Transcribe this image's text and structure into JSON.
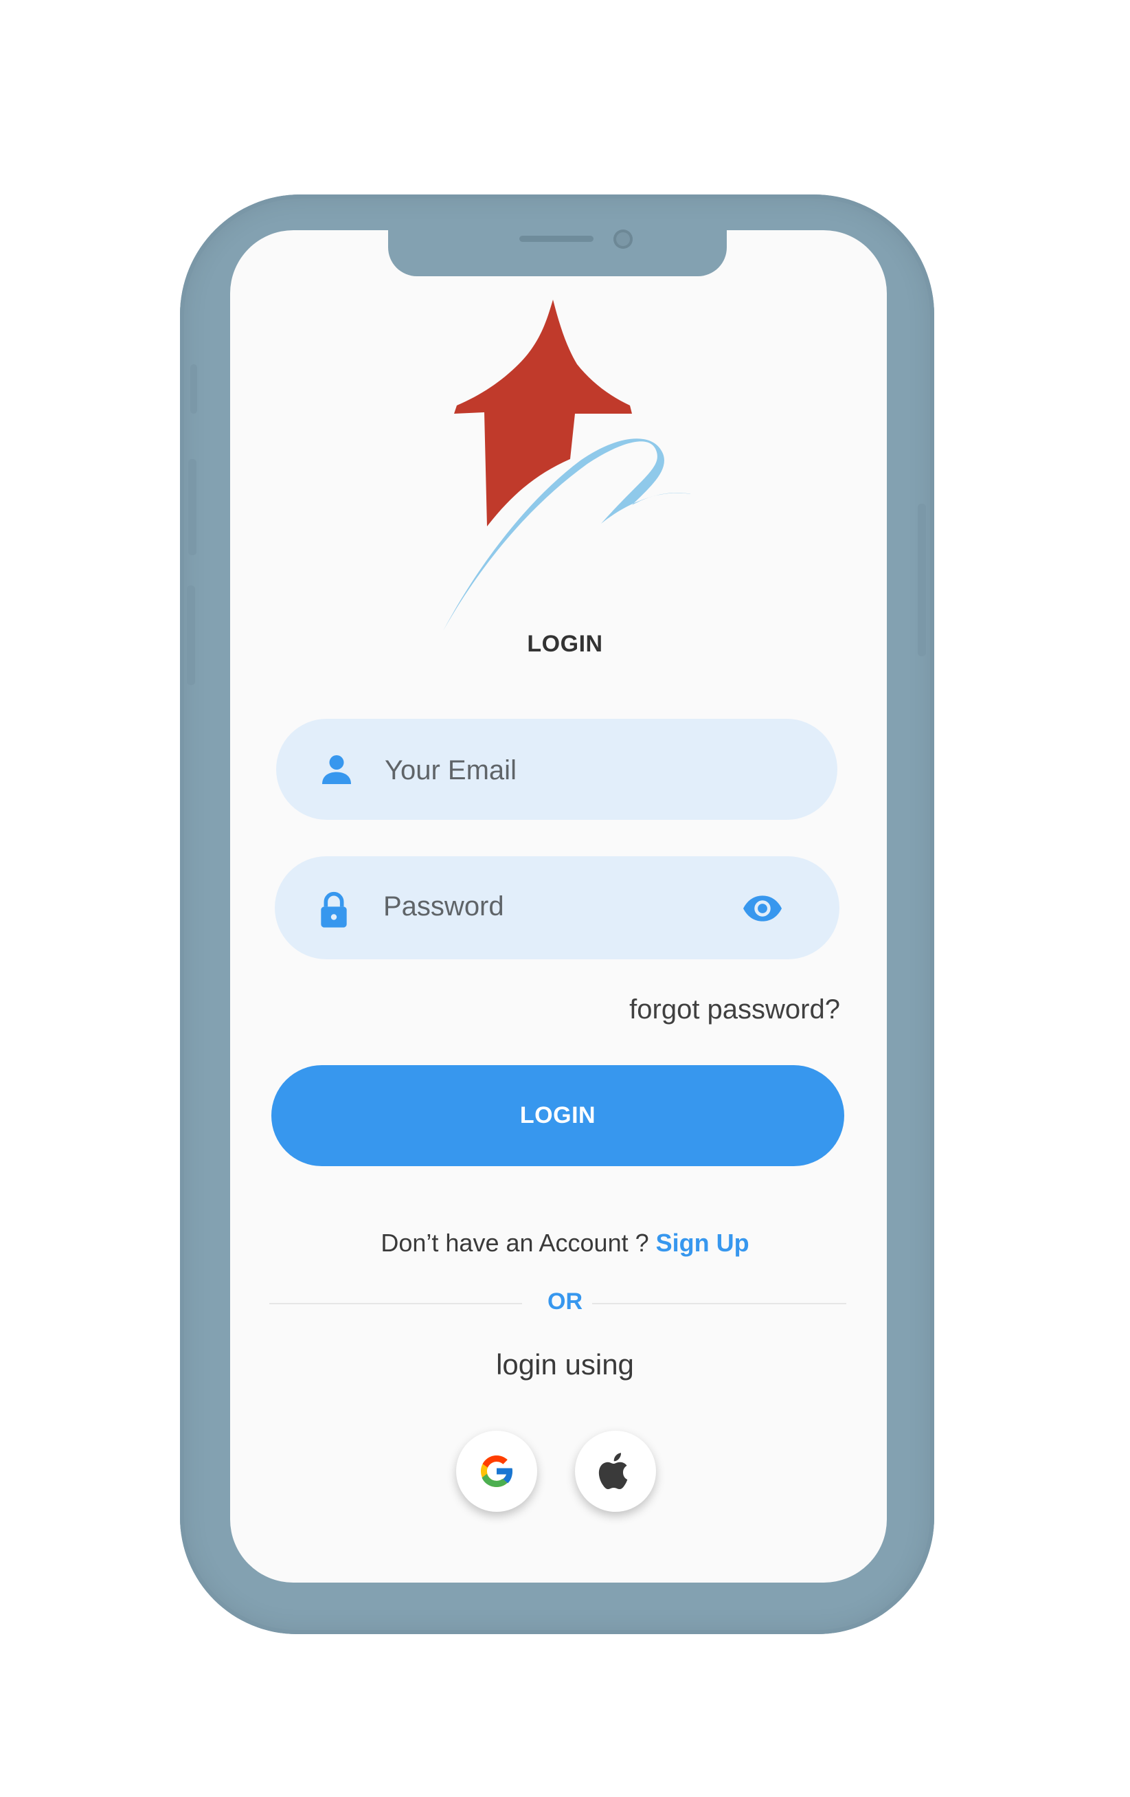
{
  "screen": {
    "title": "LOGIN"
  },
  "form": {
    "email": {
      "placeholder": "Your Email",
      "icon": "person-icon"
    },
    "password": {
      "placeholder": "Password",
      "icon": "lock-icon",
      "toggle_icon": "eye-icon"
    },
    "forgot_label": "forgot password?",
    "submit_label": "LOGIN"
  },
  "signup": {
    "prompt": "Don’t have an Account ? ",
    "link_label": "Sign Up"
  },
  "alt_login": {
    "divider_label": "OR",
    "label": "login using",
    "providers": [
      {
        "name": "google",
        "icon": "google-icon"
      },
      {
        "name": "apple",
        "icon": "apple-icon"
      }
    ]
  },
  "colors": {
    "accent": "#3797ee",
    "field_bg": "#e2eefa",
    "frame": "#83a1b1",
    "logo_arrow": "#c03a2b",
    "logo_swoosh": "#8fc9ea"
  }
}
